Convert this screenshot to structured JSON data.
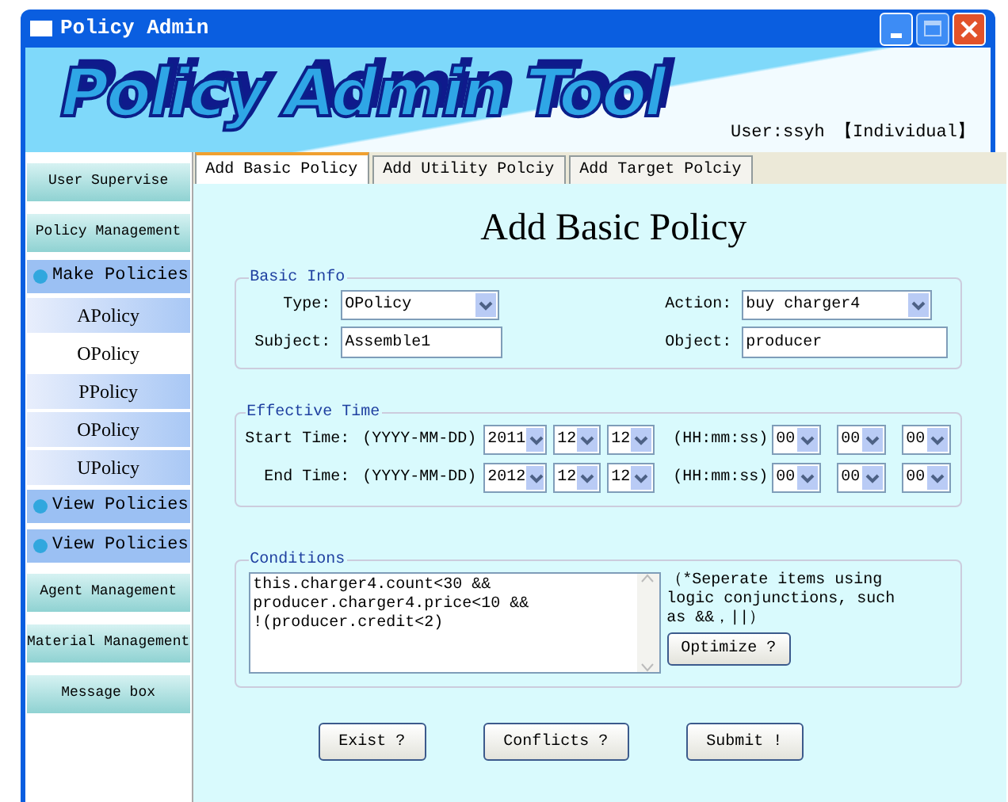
{
  "window": {
    "title": "Policy Admin"
  },
  "banner": {
    "logo": "Policy Admin Tool",
    "user": "User:ssyh 【Individual】"
  },
  "sidebar": {
    "items": [
      {
        "label": "User Supervise",
        "kind": "section",
        "selected": false
      },
      {
        "label": "Policy Management",
        "kind": "section",
        "selected": false
      },
      {
        "label": "Make Policies",
        "kind": "group",
        "selected": false
      },
      {
        "label": "APolicy",
        "kind": "item",
        "selected": false
      },
      {
        "label": "OPolicy",
        "kind": "item",
        "selected": true
      },
      {
        "label": "PPolicy",
        "kind": "item",
        "selected": false
      },
      {
        "label": "OPolicy",
        "kind": "item",
        "selected": false
      },
      {
        "label": "UPolicy",
        "kind": "item",
        "selected": false
      },
      {
        "label": "View Policies",
        "kind": "group",
        "selected": false
      },
      {
        "label": "View Policies",
        "kind": "group",
        "selected": false
      },
      {
        "label": "Agent Management",
        "kind": "section",
        "selected": false
      },
      {
        "label": "Material Management",
        "kind": "section",
        "selected": false
      },
      {
        "label": "Message box",
        "kind": "section",
        "selected": false
      }
    ]
  },
  "tabs": [
    {
      "label": "Add Basic Policy",
      "selected": true
    },
    {
      "label": "Add Utility Polciy",
      "selected": false
    },
    {
      "label": "Add Target Polciy",
      "selected": false
    }
  ],
  "heading": "Add Basic Policy",
  "basic_info": {
    "legend": "Basic Info",
    "fields": [
      {
        "label": "Type:",
        "kind": "select",
        "value": "OPolicy"
      },
      {
        "label": "Action:",
        "kind": "select",
        "value": "buy charger4"
      },
      {
        "label": "Subject:",
        "kind": "input",
        "value": "Assemble1"
      },
      {
        "label": "Object:",
        "kind": "input",
        "value": "producer"
      }
    ]
  },
  "effective_time": {
    "legend": "Effective Time",
    "rows": [
      {
        "label": "Start Time:",
        "date_format": "(YYYY-MM-DD)",
        "date": [
          "2011",
          "12",
          "12"
        ],
        "time_format": "(HH:mm:ss)",
        "time": [
          "00",
          "00",
          "00"
        ]
      },
      {
        "label": "End Time:",
        "date_format": "(YYYY-MM-DD)",
        "date": [
          "2012",
          "12",
          "12"
        ],
        "time_format": "(HH:mm:ss)",
        "time": [
          "00",
          "00",
          "00"
        ]
      }
    ]
  },
  "conditions": {
    "legend": "Conditions",
    "text": "this.charger4.count<30 &&\nproducer.charger4.price<10 &&\n!(producer.credit<2)",
    "hint": "（*Seperate items using logic conjunctions, such as &&，||）",
    "optimize": "Optimize ?"
  },
  "buttons": [
    "Exist ?",
    "Conflicts ?",
    "Submit !"
  ]
}
